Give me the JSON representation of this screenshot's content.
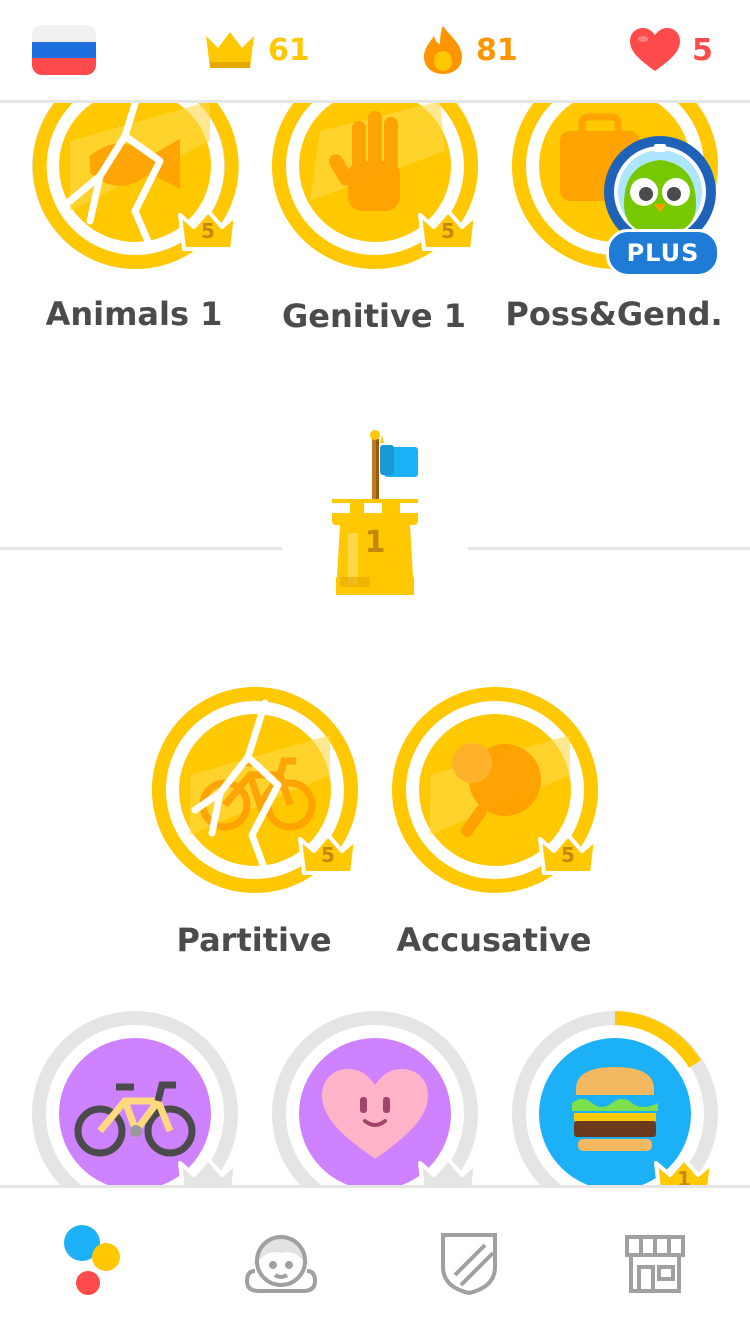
{
  "header": {
    "crowns": "61",
    "streak": "81",
    "hearts": "5",
    "colors": {
      "crown": "#ffc800",
      "streak": "#ff9600",
      "heart": "#ff4b4b"
    }
  },
  "skills_row1": [
    {
      "label": "Animals 1",
      "level": "5",
      "icon": "fish-icon",
      "cracked": true
    },
    {
      "label": "Genitive 1",
      "level": "5",
      "icon": "hand-icon",
      "cracked": false
    },
    {
      "label": "Poss&Gend.",
      "level": "5",
      "icon": "suitcase-icon",
      "cracked": false
    }
  ],
  "plus_badge": "PLUS",
  "checkpoint": {
    "number": "1"
  },
  "skills_row2": [
    {
      "label": "Partitive",
      "level": "5",
      "icon": "bicycle-icon",
      "cracked": true
    },
    {
      "label": "Accusative",
      "level": "5",
      "icon": "ping-pong-icon",
      "cracked": false
    }
  ],
  "skills_row3": [
    {
      "icon": "bicycle-icon",
      "level": ""
    },
    {
      "icon": "heart-face-icon",
      "level": ""
    },
    {
      "icon": "burger-icon",
      "level": "1"
    }
  ],
  "nav": [
    "learn-tab",
    "profile-tab",
    "leagues-tab",
    "shop-tab"
  ]
}
